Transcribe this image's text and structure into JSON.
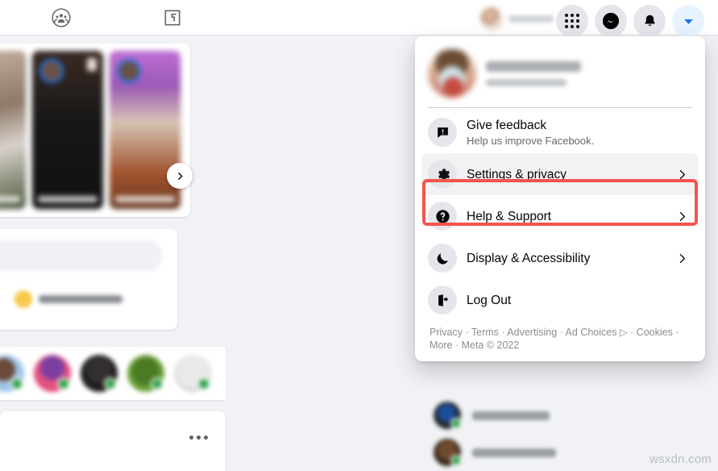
{
  "header": {
    "icons": [
      {
        "name": "groups-icon",
        "glyph": "groups"
      },
      {
        "name": "gaming-icon",
        "glyph": "gaming"
      }
    ],
    "profile_chip": {
      "name": "",
      "avatar_alt": "profile-photo"
    },
    "nav_buttons": [
      {
        "name": "menu-grid-button",
        "label": "Menu"
      },
      {
        "name": "messenger-button",
        "label": "Messenger"
      },
      {
        "name": "notifications-button",
        "label": "Notifications"
      },
      {
        "name": "account-caret-button",
        "label": "Account",
        "active": true,
        "accent": "#1877f2"
      }
    ]
  },
  "feed": {
    "stories": [
      {
        "name": "story-card-1",
        "label": ""
      },
      {
        "name": "story-card-2",
        "label": ""
      },
      {
        "name": "story-card-3",
        "label": ""
      }
    ],
    "story_next_label": "Next",
    "composer": {
      "placeholder": "",
      "action_label": ""
    },
    "contacts_strip": [
      {
        "name": "contact-avatar-1"
      },
      {
        "name": "contact-avatar-2"
      },
      {
        "name": "contact-avatar-3"
      },
      {
        "name": "contact-avatar-4"
      },
      {
        "name": "contact-avatar-5"
      }
    ],
    "post_menu_label": "More options"
  },
  "right_rail": {
    "contacts": [
      {
        "name": ""
      },
      {
        "name": ""
      }
    ]
  },
  "dropdown": {
    "account": {
      "name": "",
      "subtitle": ""
    },
    "items": [
      {
        "id": "give-feedback",
        "label": "Give feedback",
        "sublabel": "Help us improve Facebook.",
        "icon": "feedback-icon",
        "chevron": false,
        "hovered": false
      },
      {
        "id": "settings-privacy",
        "label": "Settings & privacy",
        "sublabel": "",
        "icon": "gear-icon",
        "chevron": true,
        "hovered": true
      },
      {
        "id": "help-support",
        "label": "Help & Support",
        "sublabel": "",
        "icon": "question-mark-icon",
        "chevron": true,
        "hovered": false
      },
      {
        "id": "display-accessibility",
        "label": "Display & Accessibility",
        "sublabel": "",
        "icon": "moon-icon",
        "chevron": true,
        "hovered": false
      },
      {
        "id": "log-out",
        "label": "Log Out",
        "sublabel": "",
        "icon": "logout-icon",
        "chevron": false,
        "hovered": false
      }
    ],
    "footer": "Privacy · Terms · Advertising · Ad Choices ▷ · Cookies · More · Meta © 2022"
  },
  "annotation": {
    "target": "settings-privacy",
    "color": "#f4544c"
  },
  "watermark": "wsxdn.com",
  "colors": {
    "page_background": "#f0f2f5",
    "surface": "#ffffff",
    "icon_chip": "#e4e6eb",
    "text_primary": "#050505",
    "text_secondary": "#65676b",
    "accent_blue": "#1877f2",
    "online_green": "#31a24c",
    "annotation_red": "#f4544c"
  }
}
